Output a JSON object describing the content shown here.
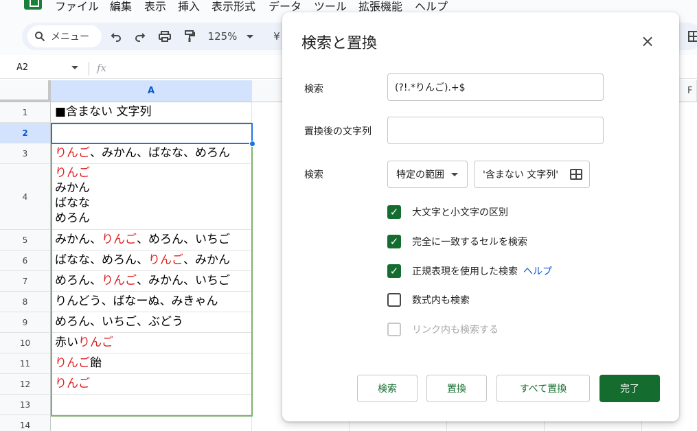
{
  "menubar": {
    "items": [
      "ファイル",
      "編集",
      "表示",
      "挿入",
      "表示形式",
      "データ",
      "ツール",
      "拡張機能",
      "ヘルプ"
    ]
  },
  "toolbar": {
    "search_label": "メニュー",
    "zoom": "125%",
    "currency_symbol": "¥"
  },
  "formula_bar": {
    "name_box": "A2",
    "fx": "fx"
  },
  "grid": {
    "col_a_header": "A",
    "col_f_header": "F",
    "row_numbers": [
      "1",
      "2",
      "3",
      "4",
      "5",
      "6",
      "7",
      "8",
      "9",
      "10",
      "11",
      "12",
      "13",
      "14"
    ],
    "rows": [
      [
        {
          "t": "■含まない 文字列",
          "r": false
        }
      ],
      [],
      [
        {
          "t": "りんご",
          "r": true
        },
        {
          "t": "、みかん、ばなな、めろん",
          "r": false
        }
      ],
      [
        {
          "t": "りんご",
          "r": true
        },
        {
          "t": "\nみかん\nばなな\nめろん",
          "r": false
        }
      ],
      [
        {
          "t": "みかん、",
          "r": false
        },
        {
          "t": "りんご",
          "r": true
        },
        {
          "t": "、めろん、いちご",
          "r": false
        }
      ],
      [
        {
          "t": "ばなな、めろん、",
          "r": false
        },
        {
          "t": "りんご",
          "r": true
        },
        {
          "t": "、みかん",
          "r": false
        }
      ],
      [
        {
          "t": "めろん、",
          "r": false
        },
        {
          "t": "りんご",
          "r": true
        },
        {
          "t": "、みかん、いちご",
          "r": false
        }
      ],
      [
        {
          "t": "りんどう、ばなーぬ、みきゃん",
          "r": false
        }
      ],
      [
        {
          "t": "めろん、いちご、ぶどう",
          "r": false
        }
      ],
      [
        {
          "t": "赤い",
          "r": false
        },
        {
          "t": "りんご",
          "r": true
        }
      ],
      [
        {
          "t": "りんご",
          "r": true
        },
        {
          "t": "飴",
          "r": false
        }
      ],
      [
        {
          "t": "りんご",
          "r": true
        }
      ],
      [],
      []
    ]
  },
  "dialog": {
    "title": "検索と置換",
    "find_label": "検索",
    "find_value": "(?!.*りんご).+$",
    "replace_label": "置換後の文字列",
    "replace_value": "",
    "scope_label": "検索",
    "scope_value": "特定の範囲",
    "range_value": "'含まない 文字列'",
    "options": [
      {
        "label": "大文字と小文字の区別",
        "state": "on"
      },
      {
        "label": "完全に一致するセルを検索",
        "state": "on"
      },
      {
        "label": "正規表現を使用した検索",
        "state": "on",
        "link": "ヘルプ"
      },
      {
        "label": "数式内も検索",
        "state": "off"
      },
      {
        "label": "リンク内も検索する",
        "state": "disabled"
      }
    ],
    "buttons": {
      "find": "検索",
      "replace": "置換",
      "replace_all": "すべて置換",
      "done": "完了"
    }
  },
  "colors": {
    "accent_green": "#146c2e",
    "selection_blue": "#1a73e8",
    "red_text": "#e01f1f"
  }
}
